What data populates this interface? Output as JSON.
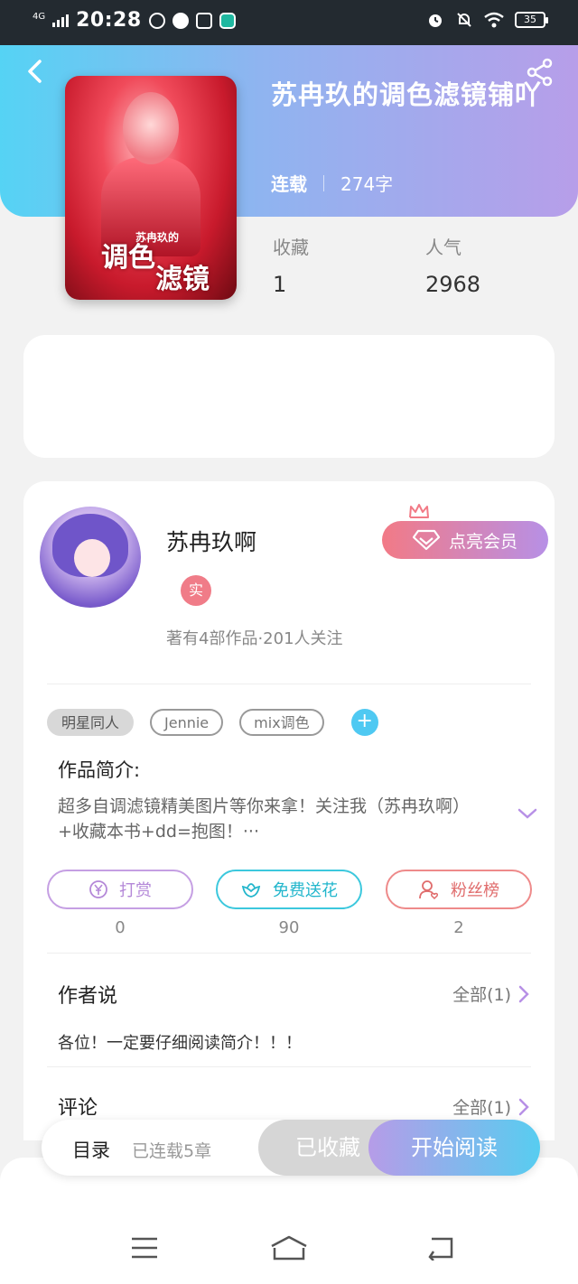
{
  "status_bar": {
    "network": "4G",
    "time": "20:28",
    "battery": "35"
  },
  "header": {
    "back_icon": "back-arrow-icon",
    "share_icon": "share-icon"
  },
  "book": {
    "title": "苏冉玖的调色滤镜铺吖",
    "status": "连载",
    "word_count": "274字",
    "cover_text_line1": "苏冉玖的",
    "cover_text_line2": "调色",
    "cover_text_line3": "滤镜",
    "stats": {
      "favorites_label": "收藏",
      "favorites_value": "1",
      "popularity_label": "人气",
      "popularity_value": "2968"
    }
  },
  "author": {
    "name": "苏冉玖啊",
    "badge": "实",
    "works_info": "著有4部作品·201人关注",
    "vip_button": "点亮会员"
  },
  "tags": [
    "明星同人",
    "Jennie",
    "mix调色"
  ],
  "intro": {
    "title": "作品简介:",
    "text": "超多自调滤镜精美图片等你来拿！关注我（苏冉玖啊）+收藏本书+dd=抱图！···"
  },
  "actions": [
    {
      "label": "打赏",
      "count": "0",
      "icon": "yen-coin-icon"
    },
    {
      "label": "免费送花",
      "count": "90",
      "icon": "flower-icon"
    },
    {
      "label": "粉丝榜",
      "count": "2",
      "icon": "fan-user-icon"
    }
  ],
  "author_says": {
    "title": "作者说",
    "more": "全部(1)",
    "content": "各位！一定要仔细阅读简介！！！"
  },
  "comments": {
    "title": "评论",
    "more": "全部(1)"
  },
  "read_bar": {
    "toc": "目录",
    "chapters": "已连载5章",
    "favorited": "已收藏",
    "start_reading": "开始阅读"
  },
  "colors": {
    "header_gradient_start": "#55d3f4",
    "header_gradient_end": "#b79ee9",
    "accent_blue": "#4fc9f2",
    "accent_pink": "#f27a86",
    "accent_purple": "#b790e6"
  }
}
